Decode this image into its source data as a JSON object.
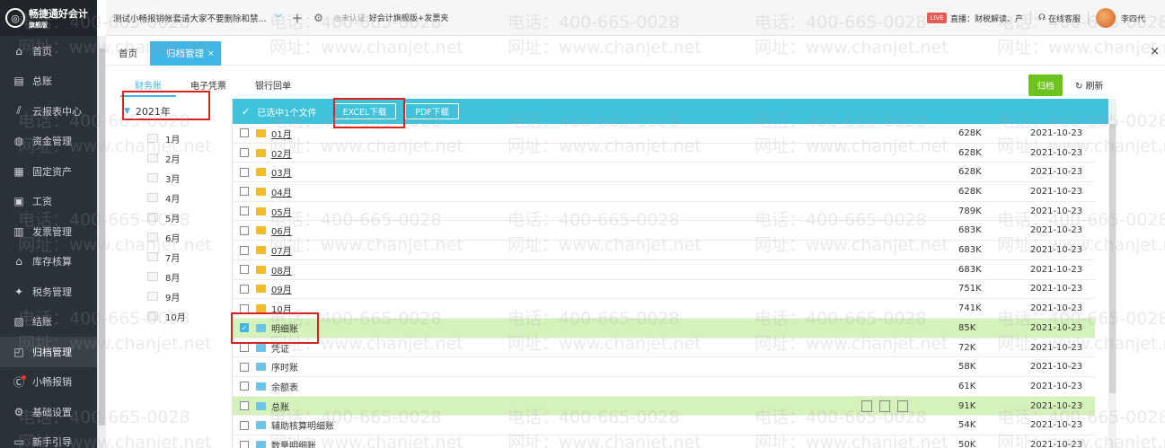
{
  "brand": {
    "name": "畅捷通好会计",
    "sub": "旗舰版"
  },
  "topbar": {
    "company": "测试小畅报销帐套请大家不要删除和禁...",
    "cert_text": "未认证",
    "plan_text": "好会计旗舰版+发票夹",
    "live_badge": "LIVE",
    "live_text": "直播：财税解读、产",
    "service_text": "在线客服",
    "user_name": "李四代"
  },
  "sidebar": {
    "items": [
      {
        "label": "首页",
        "icon": "home-icon"
      },
      {
        "label": "总账",
        "icon": "ledger-icon"
      },
      {
        "label": "云报表中心",
        "icon": "chart-icon"
      },
      {
        "label": "资金管理",
        "icon": "money-icon"
      },
      {
        "label": "固定资产",
        "icon": "asset-icon"
      },
      {
        "label": "工资",
        "icon": "salary-icon"
      },
      {
        "label": "发票管理",
        "icon": "invoice-icon"
      },
      {
        "label": "库存核算",
        "icon": "warehouse-icon"
      },
      {
        "label": "税务管理",
        "icon": "tax-icon"
      },
      {
        "label": "结账",
        "icon": "closing-icon"
      },
      {
        "label": "归档管理",
        "icon": "archive-icon",
        "active": true
      },
      {
        "label": "小畅报销",
        "icon": "reimburse-icon",
        "dot": true
      },
      {
        "label": "基础设置",
        "icon": "settings-icon"
      },
      {
        "label": "新手引导",
        "icon": "guide-icon"
      }
    ]
  },
  "tabs": {
    "home": "首页",
    "archive": "归档管理",
    "archive_close": "×",
    "window_close": "×"
  },
  "subtabs": [
    "财务账",
    "电子凭票",
    "银行回单"
  ],
  "buttons": {
    "archive": "归档",
    "refresh": "刷新"
  },
  "tree": {
    "root": "2021年",
    "months": [
      "1月",
      "2月",
      "3月",
      "4月",
      "5月",
      "6月",
      "7月",
      "8月",
      "9月",
      "10月"
    ]
  },
  "selection": {
    "text": "已选中1个文件",
    "excel": "EXCEL下载",
    "pdf": "PDF下载"
  },
  "files": [
    {
      "name": "01月",
      "type": "folder",
      "size": "628K",
      "date": "2021-10-23"
    },
    {
      "name": "02月",
      "type": "folder",
      "size": "628K",
      "date": "2021-10-23"
    },
    {
      "name": "03月",
      "type": "folder",
      "size": "628K",
      "date": "2021-10-23"
    },
    {
      "name": "04月",
      "type": "folder",
      "size": "628K",
      "date": "2021-10-23"
    },
    {
      "name": "05月",
      "type": "folder",
      "size": "789K",
      "date": "2021-10-23"
    },
    {
      "name": "06月",
      "type": "folder",
      "size": "683K",
      "date": "2021-10-23"
    },
    {
      "name": "07月",
      "type": "folder",
      "size": "683K",
      "date": "2021-10-23"
    },
    {
      "name": "08月",
      "type": "folder",
      "size": "683K",
      "date": "2021-10-23"
    },
    {
      "name": "09月",
      "type": "folder",
      "size": "751K",
      "date": "2021-10-23"
    },
    {
      "name": "10月",
      "type": "folder",
      "size": "741K",
      "date": "2021-10-23"
    },
    {
      "name": "明细账",
      "type": "doc",
      "size": "85K",
      "date": "2021-10-23",
      "checked": true,
      "highlight": true
    },
    {
      "name": "凭证",
      "type": "doc",
      "size": "72K",
      "date": "2021-10-23"
    },
    {
      "name": "序时账",
      "type": "doc",
      "size": "58K",
      "date": "2021-10-23"
    },
    {
      "name": "余额表",
      "type": "doc",
      "size": "61K",
      "date": "2021-10-23"
    },
    {
      "name": "总账",
      "type": "doc",
      "size": "91K",
      "date": "2021-10-23",
      "highlight": true,
      "actions": true
    },
    {
      "name": "辅助核算明细账",
      "type": "doc",
      "size": "54K",
      "date": "2021-10-23"
    },
    {
      "name": "数量明细账",
      "type": "doc",
      "size": "50K",
      "date": "2021-10-23"
    }
  ],
  "watermark": {
    "phone": "电话：400-665-0028",
    "url": "网址：www.chanjet.net"
  },
  "colors": {
    "accent": "#3fb6e6",
    "selbar": "#3fc2dc",
    "green": "#6cc21f",
    "highlight": "#d6f2bb",
    "sidebar": "#2b3138",
    "annotation": "#e02020"
  }
}
